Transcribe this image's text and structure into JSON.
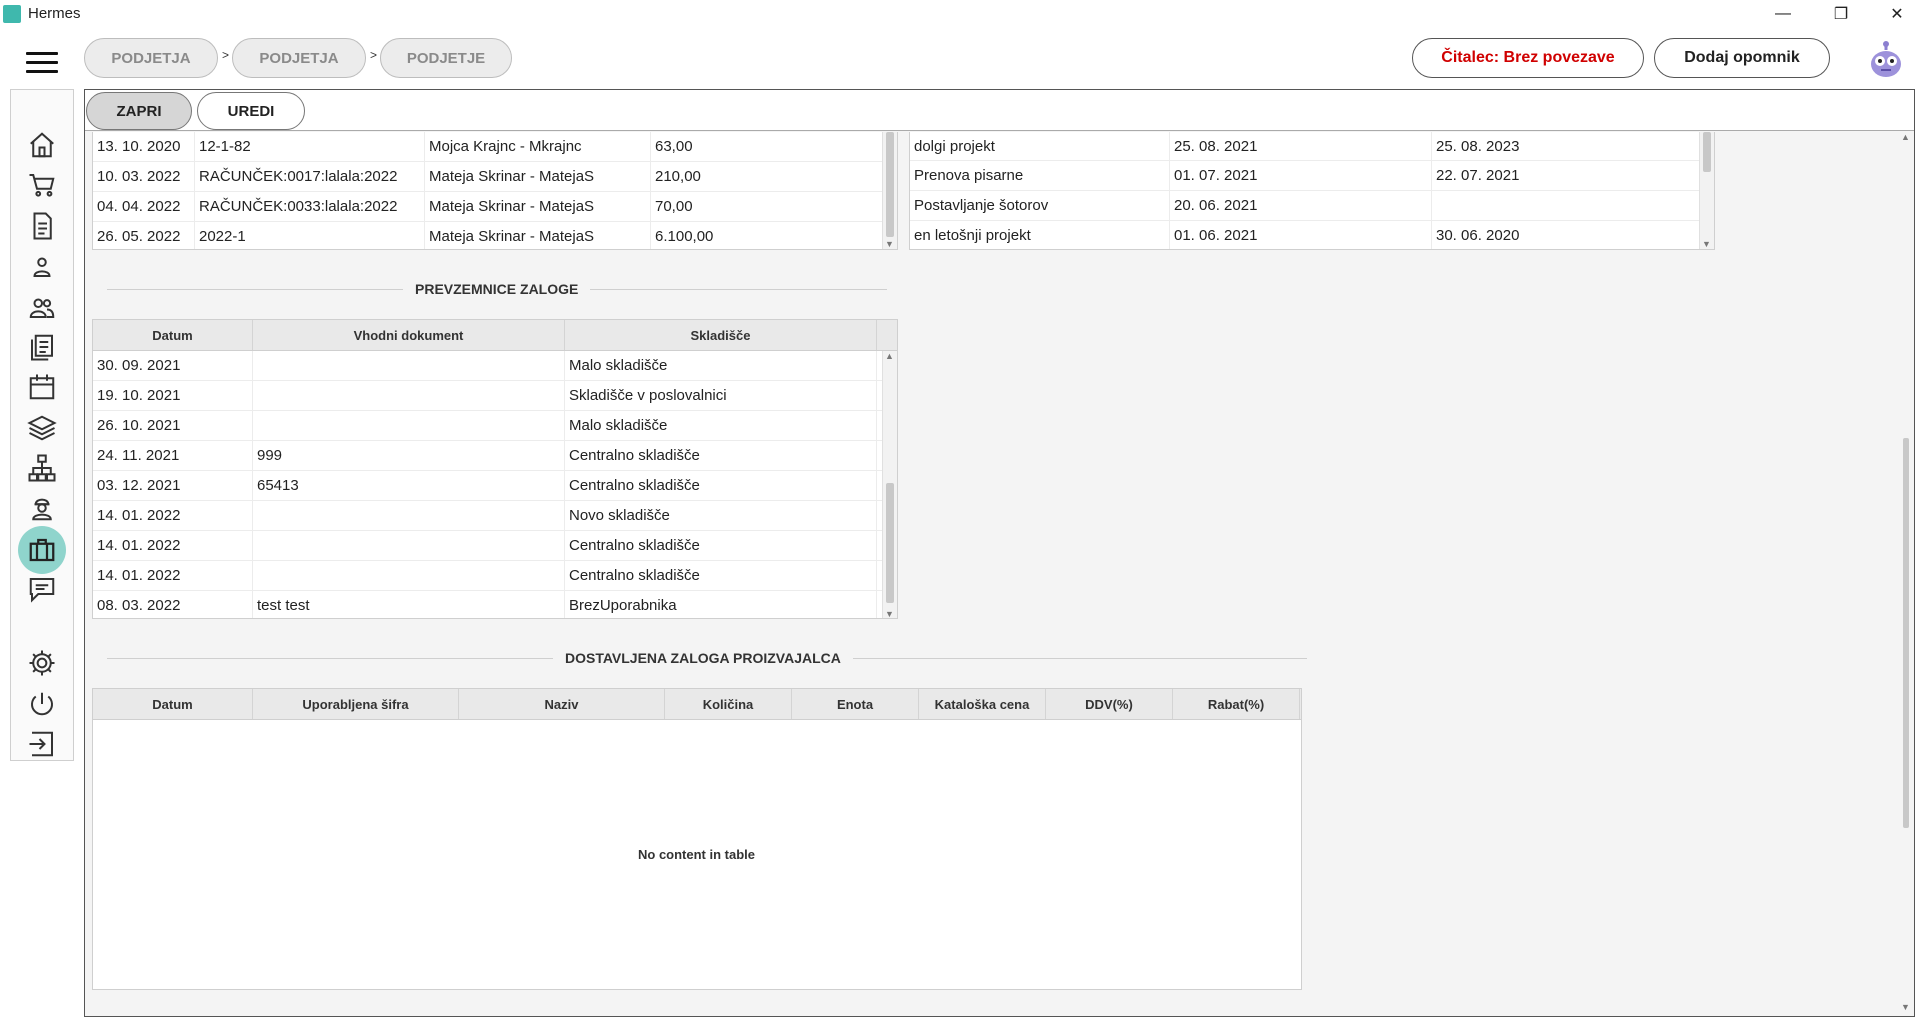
{
  "window": {
    "title": "Hermes",
    "controls": [
      "—",
      "❐",
      "✕"
    ]
  },
  "breadcrumbs": [
    {
      "label": "PODJETJA"
    },
    {
      "label": "PODJETJA"
    },
    {
      "label": "PODJETJE"
    }
  ],
  "breadcrumb_separator": ">",
  "header_buttons": {
    "reader_status": "Čitalec: Brez povezave",
    "reader_status_color": "#d00000",
    "add_reminder": "Dodaj opomnik"
  },
  "sidebar_icons": [
    "home-icon",
    "cart-icon",
    "document-icon",
    "person-icon",
    "people-icon",
    "documents-icon",
    "calendar-icon",
    "layers-icon",
    "network-icon",
    "worker-icon",
    "briefcase-icon",
    "chat-icon",
    "gear-icon",
    "power-icon",
    "logout-icon"
  ],
  "tabs": {
    "close": "ZAPRI",
    "edit": "UREDI"
  },
  "invoices_table": {
    "rows": [
      [
        "13. 10. 2020",
        "12-1-82",
        "Mojca Krajnc - Mkrajnc",
        "63,00"
      ],
      [
        "10. 03. 2022",
        "RAČUNČEK:0017:lalala:2022",
        "Mateja Skrinar - MatejaS",
        "210,00"
      ],
      [
        "04. 04. 2022",
        "RAČUNČEK:0033:lalala:2022",
        "Mateja Skrinar - MatejaS",
        "70,00"
      ],
      [
        "26. 05. 2022",
        "2022-1",
        "Mateja Skrinar - MatejaS",
        "6.100,00"
      ]
    ]
  },
  "projects_table": {
    "rows": [
      [
        "dolgi projekt",
        "25. 08. 2021",
        "25. 08. 2023"
      ],
      [
        "Prenova pisarne",
        "01. 07. 2021",
        "22. 07. 2021"
      ],
      [
        "Postavljanje šotorov",
        "20. 06. 2021",
        ""
      ],
      [
        "en letošnji projekt",
        "01. 06. 2021",
        "30. 06. 2020"
      ]
    ]
  },
  "stock_receipts": {
    "title": "PREVZEMNICE ZALOGE",
    "columns": [
      "Datum",
      "Vhodni dokument",
      "Skladišče"
    ],
    "rows": [
      [
        "30. 09. 2021",
        "",
        "Malo skladišče"
      ],
      [
        "19. 10. 2021",
        "",
        "Skladišče v poslovalnici"
      ],
      [
        "26. 10. 2021",
        "",
        "Malo skladišče"
      ],
      [
        "24. 11. 2021",
        "999",
        "Centralno skladišče"
      ],
      [
        "03. 12. 2021",
        "65413",
        "Centralno skladišče"
      ],
      [
        "14. 01. 2022",
        "",
        "Novo skladišče"
      ],
      [
        "14. 01. 2022",
        "",
        "Centralno skladišče"
      ],
      [
        "14. 01. 2022",
        "",
        "Centralno skladišče"
      ],
      [
        "08. 03. 2022",
        "test test",
        "BrezUporabnika"
      ]
    ]
  },
  "manufacturer_stock": {
    "title": "DOSTAVLJENA ZALOGA PROIZVAJALCA",
    "columns": [
      "Datum",
      "Uporabljena šifra",
      "Naziv",
      "Količina",
      "Enota",
      "Kataloška cena",
      "DDV(%)",
      "Rabat(%)"
    ],
    "empty_message": "No content in table"
  }
}
